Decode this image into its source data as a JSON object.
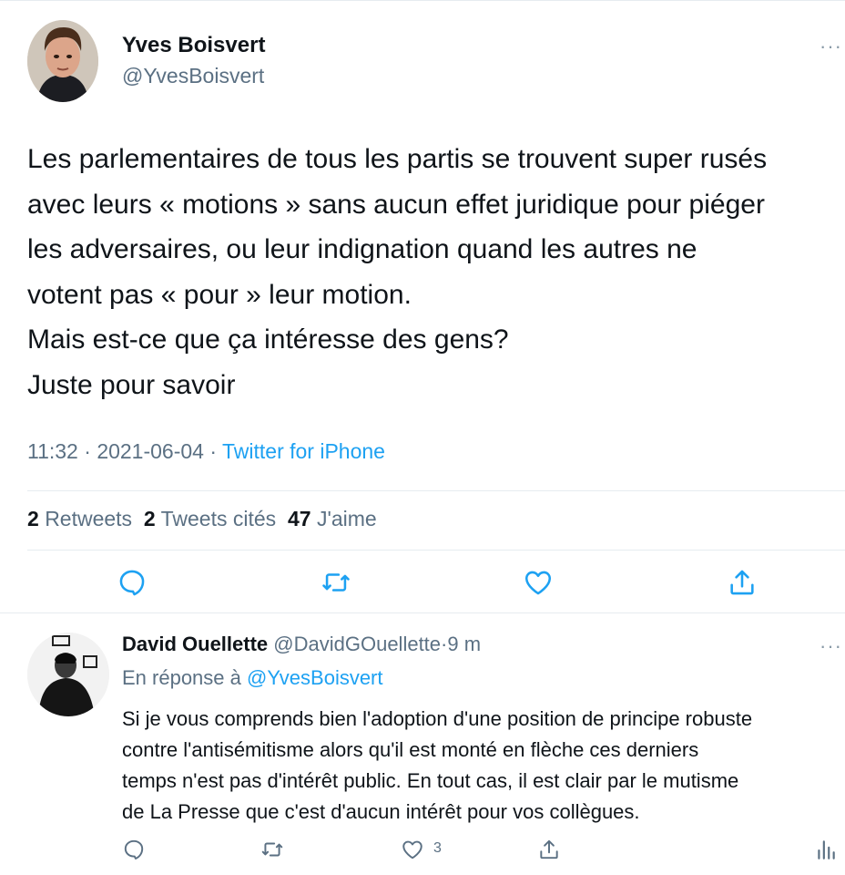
{
  "tweet": {
    "author": {
      "name": "Yves Boisvert",
      "handle": "@YvesBoisvert"
    },
    "lines": [
      "Les parlementaires de tous les partis se trouvent super rusés",
      "avec leurs « motions » sans aucun effet juridique pour piéger",
      "les adversaires, ou leur indignation quand les autres ne",
      "votent pas « pour » leur motion.",
      "Mais est-ce que ça intéresse des gens?",
      "Juste pour savoir"
    ],
    "time": "11:32",
    "date": "2021-06-04",
    "separator": " · ",
    "source": "Twitter for iPhone",
    "stats": {
      "retweets_count": "2",
      "retweets_label": "Retweets",
      "quotes_count": "2",
      "quotes_label": "Tweets cités",
      "likes_count": "47",
      "likes_label": "J'aime"
    },
    "more": "···"
  },
  "reply": {
    "author": {
      "name": "David Ouellette",
      "handle": "@DavidGOuellette"
    },
    "time_sep": "·",
    "time": "9 m",
    "more": "···",
    "reply_to_label": "En réponse à",
    "reply_to_handle": "@YvesBoisvert",
    "lines": [
      "Si je vous comprends bien l'adoption d'une position de principe robuste",
      "contre l'antisémitisme alors qu'il est monté en flèche ces derniers",
      "temps n'est pas d'intérêt public. En tout cas, il est clair par le mutisme",
      "de La Presse que c'est d'aucun intérêt pour vos collègues."
    ],
    "like_count": "3"
  },
  "icons": {
    "action_color": "#1da1f2",
    "reply_action_color": "#5b7083",
    "names": [
      "reply-icon",
      "retweet-icon",
      "like-icon",
      "share-icon",
      "analytics-icon",
      "more-icon"
    ]
  }
}
